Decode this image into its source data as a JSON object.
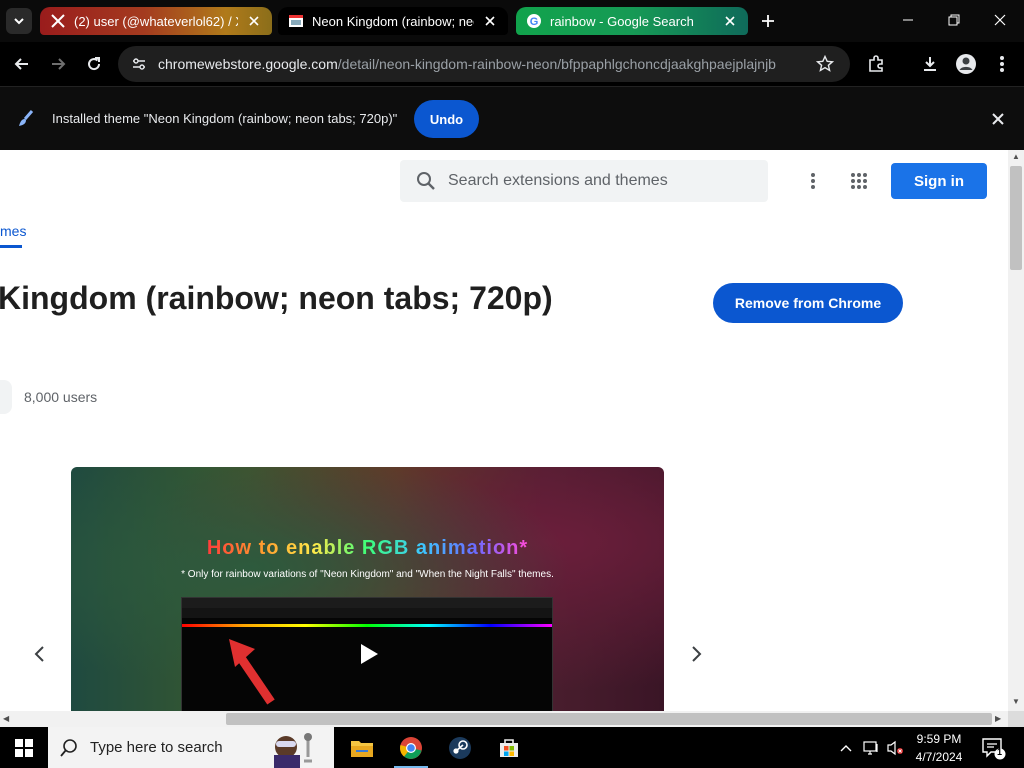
{
  "browser": {
    "tabs": [
      {
        "title": "(2) user (@whateverlol62) / X",
        "icon": "x-logo-icon"
      },
      {
        "title": "Neon Kingdom (rainbow; neon tabs; 720p)",
        "icon": "theme-favicon-icon",
        "active": true
      },
      {
        "title": "rainbow - Google Search",
        "icon": "google-g-icon"
      }
    ],
    "url_host": "chromewebstore.google.com",
    "url_path": "/detail/neon-kingdom-rainbow-neon/bfppaphlgchoncdjaakghpaejplajnjb",
    "infobar": {
      "message": "Installed theme \"Neon Kingdom (rainbow; neon tabs; 720p)\"",
      "undo_label": "Undo"
    }
  },
  "page": {
    "search_placeholder": "Search extensions and themes",
    "signin_label": "Sign in",
    "breadcrumb": "mes",
    "title": "Kingdom (rainbow; neon tabs; 720p)",
    "remove_label": "Remove from Chrome",
    "users": "8,000 users",
    "video": {
      "title": "How to enable RGB animation*",
      "subtitle": "* Only for rainbow variations of \"Neon Kingdom\" and \"When the Night Falls\" themes."
    }
  },
  "taskbar": {
    "search_placeholder": "Type here to search",
    "time": "9:59 PM",
    "date": "4/7/2024",
    "notification_count": "1"
  },
  "colors": {
    "accent": "#0b57d0",
    "signin": "#1a73e8"
  }
}
